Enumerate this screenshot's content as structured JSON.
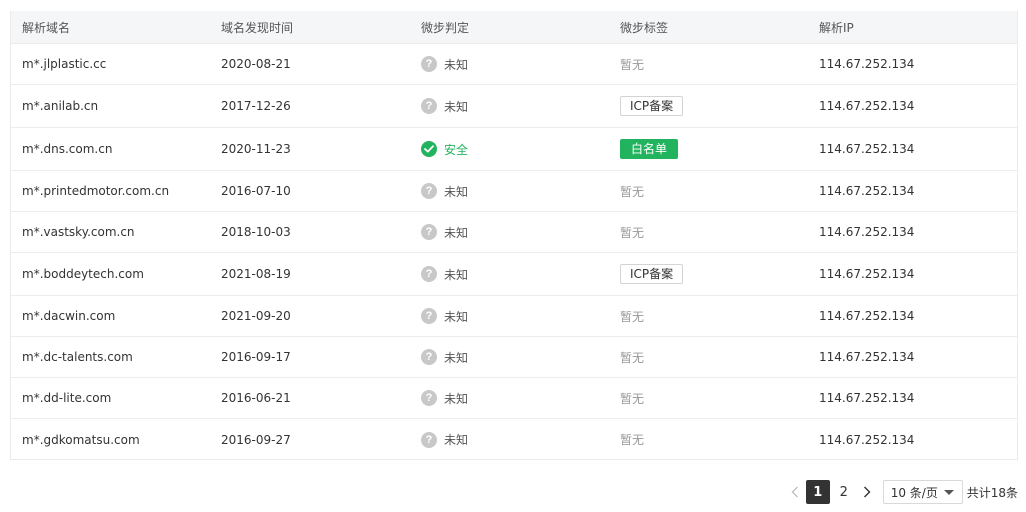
{
  "table": {
    "columns": [
      "解析域名",
      "域名发现时间",
      "微步判定",
      "微步标签",
      "解析IP"
    ],
    "rows": [
      {
        "domain": "m*.jlplastic.cc",
        "date": "2020-08-21",
        "verdict": "未知",
        "verdict_icon": "question-icon",
        "tag": "暂无",
        "tag_style": "none",
        "ip": "114.67.252.134",
        "height": 41
      },
      {
        "domain": "m*.anilab.cn",
        "date": "2017-12-26",
        "verdict": "未知",
        "verdict_icon": "question-icon",
        "tag": "ICP备案",
        "tag_style": "outline",
        "ip": "114.67.252.134",
        "height": 43
      },
      {
        "domain": "m*.dns.com.cn",
        "date": "2020-11-23",
        "verdict": "安全",
        "verdict_icon": "check-circle-icon",
        "tag": "白名单",
        "tag_style": "green",
        "ip": "114.67.252.134",
        "height": 43
      },
      {
        "domain": "m*.printedmotor.com.cn",
        "date": "2016-07-10",
        "verdict": "未知",
        "verdict_icon": "question-icon",
        "tag": "暂无",
        "tag_style": "none",
        "ip": "114.67.252.134",
        "height": 41
      },
      {
        "domain": "m*.vastsky.com.cn",
        "date": "2018-10-03",
        "verdict": "未知",
        "verdict_icon": "question-icon",
        "tag": "暂无",
        "tag_style": "none",
        "ip": "114.67.252.134",
        "height": 41
      },
      {
        "domain": "m*.boddeytech.com",
        "date": "2021-08-19",
        "verdict": "未知",
        "verdict_icon": "question-icon",
        "tag": "ICP备案",
        "tag_style": "outline",
        "ip": "114.67.252.134",
        "height": 43
      },
      {
        "domain": "m*.dacwin.com",
        "date": "2021-09-20",
        "verdict": "未知",
        "verdict_icon": "question-icon",
        "tag": "暂无",
        "tag_style": "none",
        "ip": "114.67.252.134",
        "height": 41
      },
      {
        "domain": "m*.dc-talents.com",
        "date": "2016-09-17",
        "verdict": "未知",
        "verdict_icon": "question-icon",
        "tag": "暂无",
        "tag_style": "none",
        "ip": "114.67.252.134",
        "height": 41
      },
      {
        "domain": "m*.dd-lite.com",
        "date": "2016-06-21",
        "verdict": "未知",
        "verdict_icon": "question-icon",
        "tag": "暂无",
        "tag_style": "none",
        "ip": "114.67.252.134",
        "height": 41
      },
      {
        "domain": "m*.gdkomatsu.com",
        "date": "2016-09-27",
        "verdict": "未知",
        "verdict_icon": "question-icon",
        "tag": "暂无",
        "tag_style": "none",
        "ip": "114.67.252.134",
        "height": 41
      }
    ]
  },
  "pagination": {
    "prev_icon": "chevron-left-icon",
    "pages": [
      "1",
      "2"
    ],
    "current_page": "1",
    "next_icon": "chevron-right-icon",
    "page_size": "10 条/页",
    "total": "共计18条"
  },
  "colors": {
    "safe": "#22b35e",
    "unknown": "#c8c8c8",
    "header_bg": "#f5f6f8"
  }
}
